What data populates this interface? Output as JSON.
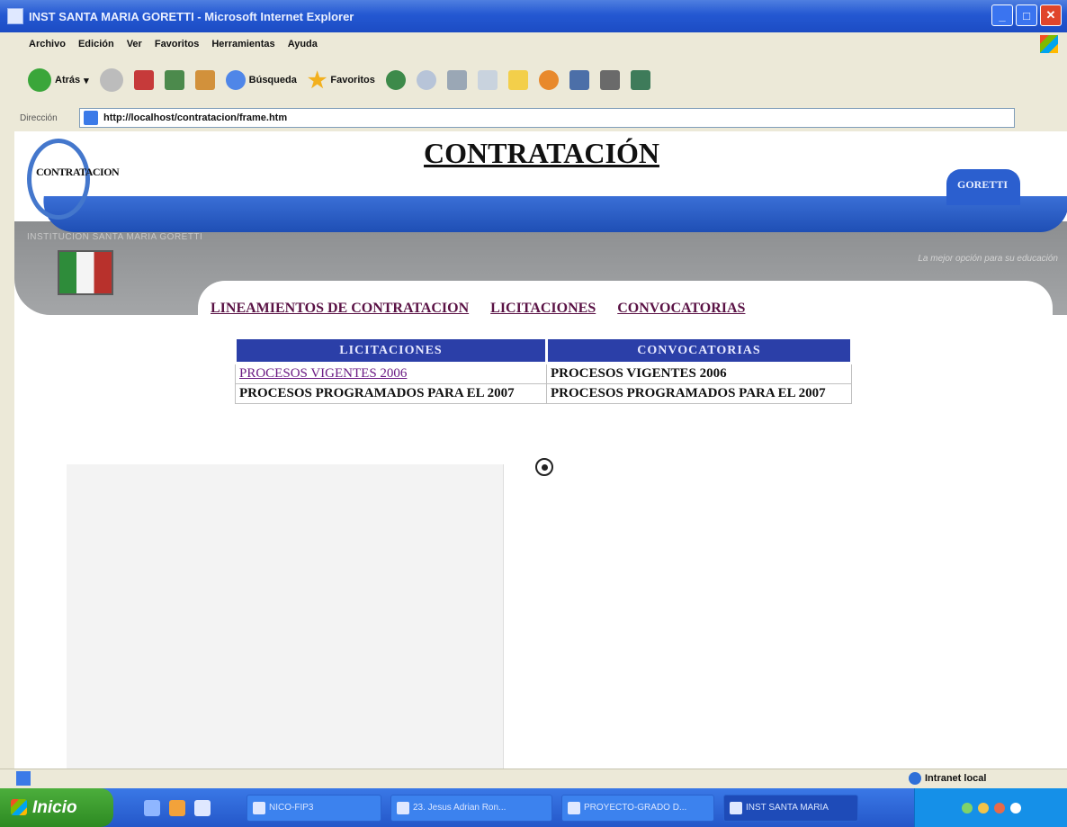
{
  "window": {
    "title": "INST SANTA MARIA GORETTI - Microsoft Internet Explorer"
  },
  "menu": [
    "Archivo",
    "Edición",
    "Ver",
    "Favoritos",
    "Herramientas",
    "Ayuda"
  ],
  "toolbar": {
    "back_label": "Atrás",
    "search_label": "Búsqueda",
    "favorites_label": "Favoritos"
  },
  "address": {
    "label": "Dirección",
    "url": "http://localhost/contratacion/frame.htm"
  },
  "banner": {
    "brand": "CONTRATACION",
    "goretti": "GORETTI",
    "institution": "INSTITUCION SANTA MARIA GORETTI",
    "slogan": "La mejor opción para su educación"
  },
  "page": {
    "title": "CONTRATACIÓN"
  },
  "nav": [
    "LINEAMIENTOS DE CONTRATACION",
    "LICITACIONES",
    "CONVOCATORIAS"
  ],
  "table": {
    "headers": [
      "LICITACIONES",
      "CONVOCATORIAS"
    ],
    "rows": [
      [
        "PROCESOS VIGENTES 2006",
        "PROCESOS VIGENTES 2006"
      ],
      [
        "PROCESOS PROGRAMADOS PARA EL 2007",
        "PROCESOS PROGRAMADOS PARA EL 2007"
      ]
    ]
  },
  "status": {
    "zone": "Intranet local"
  },
  "taskbar": {
    "start": "Inicio",
    "tasks": [
      "NICO-FIP3",
      "23. Jesus Adrian Ron...",
      "PROYECTO-GRADO D...",
      "INST SANTA MARIA"
    ]
  }
}
